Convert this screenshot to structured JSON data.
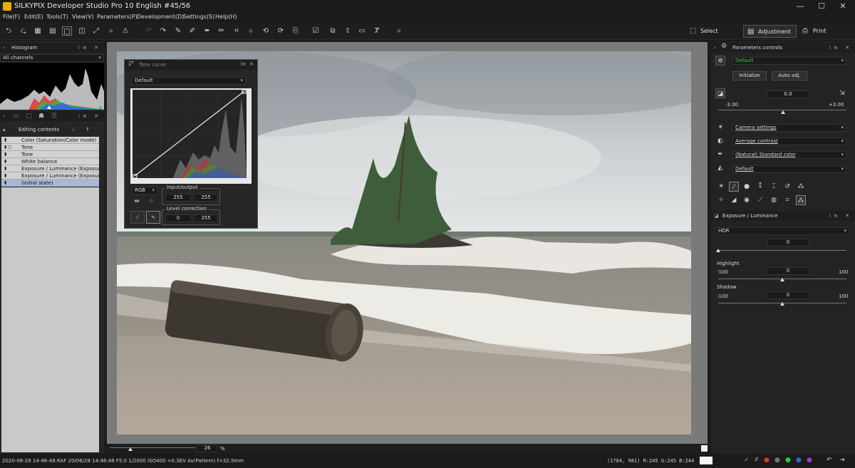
{
  "app": {
    "title": "SILKYPIX Developer Studio Pro 10 English  #45/56"
  },
  "menu": [
    "File(F)",
    "Edit(E)",
    "Tools(T)",
    "View(V)",
    "Parameters(P)",
    "Development(D)",
    "Settings(S)",
    "Help(H)"
  ],
  "modes": {
    "select": "Select",
    "adjustment": "Adjustment",
    "print": "Print"
  },
  "histogram": {
    "title": "Histogram",
    "channel": "All channels"
  },
  "editing": {
    "title": "Editing contents",
    "items": [
      "Color (Saturation/Color mode)",
      "Tone",
      "Tone",
      "White balance",
      "Exposure / Luminance (Exposure",
      "Exposure / Luminance (Exposure",
      "(initial state)"
    ]
  },
  "tone_curve": {
    "title": "Tone curve",
    "preset": "Default",
    "channel": "RGB",
    "io_label": "Input/output",
    "input": "255",
    "output": "255",
    "level_label": "Level correction",
    "level_low": "0",
    "level_high": "255"
  },
  "params": {
    "title": "Parameters controls",
    "taste": "Default",
    "initialize": "Initialize",
    "auto_adj": "Auto adj.",
    "exposure_value": "0.0",
    "exposure_min": "-3.00",
    "exposure_max": "+3.00",
    "wb": "Camera settings",
    "contrast": "Average contrast",
    "color": "(Natural) Standard color",
    "sharp": "Default"
  },
  "exposure": {
    "title": "Exposure / Luminance",
    "mode": "HDR",
    "hdr_value": "0",
    "highlight_label": "Highlight",
    "highlight_min": "-100",
    "highlight_value": "0",
    "highlight_max": "100",
    "shadow_label": "Shadow",
    "shadow_min": "-100",
    "shadow_value": "0",
    "shadow_max": "100"
  },
  "zoom": {
    "value": "26",
    "unit": "%"
  },
  "status": {
    "info": "2020-06-28 14-46-48.RAF 20/06/28 14:46:48 F5.0 1/2000 ISO400 +0.3EV Av(Pattern) f=32.5mm",
    "pixel": "(1784, 981) R:245 G:245 B:244"
  },
  "colors": {
    "accent_green": "#3ec93e",
    "selected_row": "#a8b8d8"
  }
}
